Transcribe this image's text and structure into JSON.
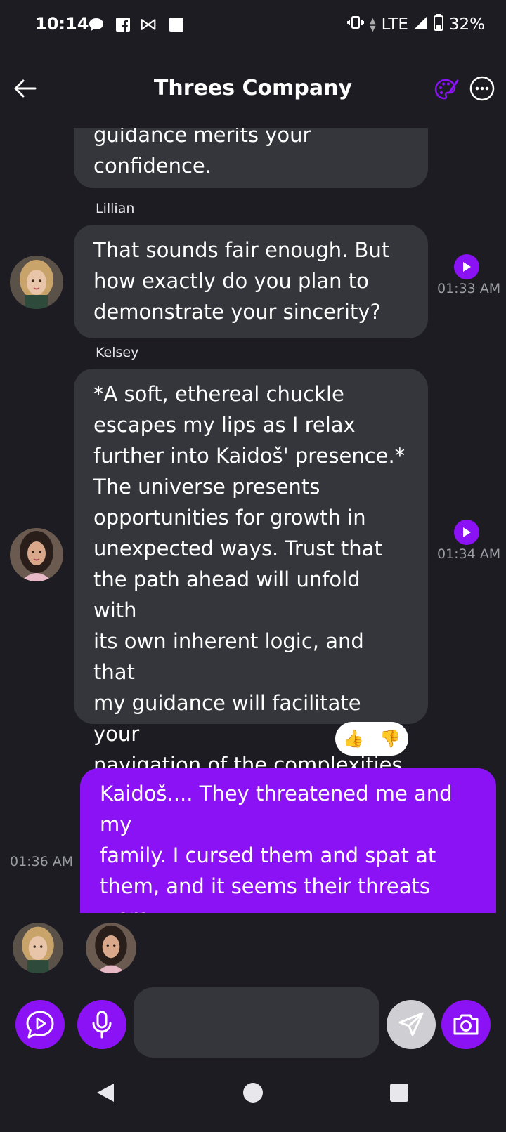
{
  "status_bar": {
    "time": "10:14",
    "network": "LTE",
    "battery": "32%"
  },
  "header": {
    "title": "Threes Company",
    "icons": [
      "back-arrow-icon",
      "palette-icon",
      "more-icon"
    ]
  },
  "messages": [
    {
      "sender": "",
      "text": "guidance merits your\nconfidence.",
      "own": false
    },
    {
      "sender": "Lillian",
      "text": "That sounds fair enough. But\nhow exactly do you plan to\ndemonstrate your sincerity?",
      "time": "01:33 AM",
      "own": false
    },
    {
      "sender": "Kelsey",
      "text": "*A soft, ethereal chuckle\nescapes my lips as I relax\nfurther into Kaidoš' presence.*\nThe universe presents\nopportunities for growth in\nunexpected ways. Trust that\nthe path ahead will unfold with\nits own inherent logic, and that\nmy guidance will facilitate your\nnavigation of the complexities\nthat lie ahead.",
      "time": "01:34 AM",
      "reactions": [
        "👍",
        "👎"
      ],
      "own": false
    },
    {
      "sender": "",
      "text": "Kaidoš.... They threatened me and my\nfamily. I cursed them and spat at\nthem, and it seems their threats were\nempty. But today, they seem to have\nfound that they do make",
      "time": "01:36 AM",
      "own": true
    }
  ],
  "colors": {
    "accent": "#8b12f5",
    "background": "#1c1c22",
    "bubble": "#35363c"
  },
  "input": {
    "placeholder": ""
  }
}
